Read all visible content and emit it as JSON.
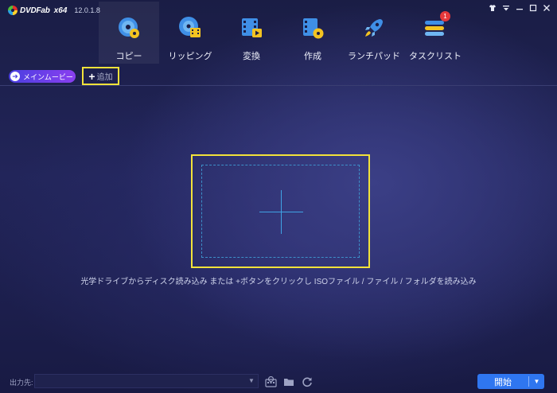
{
  "app": {
    "brand": "DVDFab",
    "arch": "x64",
    "version": "12.0.1.8"
  },
  "window_controls": [
    "shirt-icon",
    "menu-icon",
    "minimize-icon",
    "maximize-icon",
    "close-icon"
  ],
  "toolbar": [
    {
      "key": "copy",
      "label": "コピー",
      "icon": "disc-copy-icon",
      "active": true
    },
    {
      "key": "ripper",
      "label": "リッピング",
      "icon": "disc-ripper-icon",
      "active": false
    },
    {
      "key": "converter",
      "label": "変換",
      "icon": "film-converter-icon",
      "active": false
    },
    {
      "key": "creator",
      "label": "作成",
      "icon": "film-creator-icon",
      "active": false
    },
    {
      "key": "launchpad",
      "label": "ランチパッド",
      "icon": "rocket-icon",
      "active": false
    },
    {
      "key": "tasks",
      "label": "タスクリスト",
      "icon": "task-list-icon",
      "active": false,
      "badge": "1"
    }
  ],
  "subbar": {
    "main_movie_label": "メインムービー",
    "add_label": "追加"
  },
  "drop_zone": {
    "hint": "光学ドライブからディスク読み込み または +ボタンをクリックし ISOファイル / ファイル / フォルダを読み込み"
  },
  "bottom": {
    "output_label": "出力先:",
    "output_value": "",
    "start_label": "開始"
  },
  "colors": {
    "highlight": "#f2e23a",
    "start_button": "#2f76f0",
    "badge": "#e5383b",
    "main_movie_gradient_start": "#4a3fe0",
    "main_movie_gradient_end": "#8a3ff0"
  }
}
